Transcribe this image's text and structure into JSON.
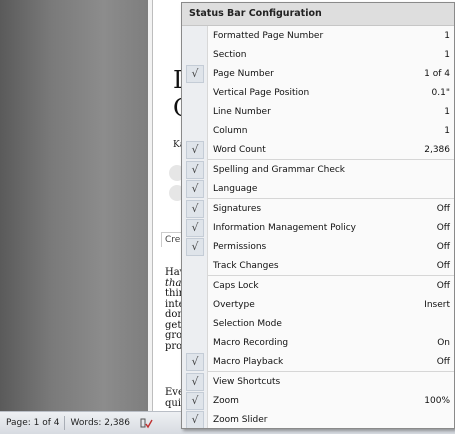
{
  "document": {
    "heading1": "In",
    "heading2": "C",
    "author": "Kat",
    "caption": "Crea",
    "body_lines": [
      "Havi",
      "that",
      "thing",
      "inte",
      "don'",
      "get s",
      "grow",
      "prod"
    ],
    "body_lines2": [
      "Ever",
      "quic"
    ]
  },
  "menu": {
    "title": "Status Bar Configuration",
    "items": [
      {
        "label": "Formatted Page Number",
        "value": "1",
        "checked": false
      },
      {
        "label": "Section",
        "value": "1",
        "checked": false
      },
      {
        "label": "Page Number",
        "value": "1 of 4",
        "checked": true
      },
      {
        "label": "Vertical Page Position",
        "value": "0.1\"",
        "checked": false
      },
      {
        "label": "Line Number",
        "value": "1",
        "checked": false
      },
      {
        "label": "Column",
        "value": "1",
        "checked": false
      },
      {
        "label": "Word Count",
        "value": "2,386",
        "checked": true
      },
      {
        "label": "Spelling and Grammar Check",
        "value": "",
        "checked": true
      },
      {
        "label": "Language",
        "value": "",
        "checked": true
      },
      {
        "label": "Signatures",
        "value": "Off",
        "checked": true
      },
      {
        "label": "Information Management Policy",
        "value": "Off",
        "checked": true
      },
      {
        "label": "Permissions",
        "value": "Off",
        "checked": true
      },
      {
        "label": "Track Changes",
        "value": "Off",
        "checked": false
      },
      {
        "label": "Caps Lock",
        "value": "Off",
        "checked": false
      },
      {
        "label": "Overtype",
        "value": "Insert",
        "checked": false
      },
      {
        "label": "Selection Mode",
        "value": "",
        "checked": false
      },
      {
        "label": "Macro Recording",
        "value": "On",
        "checked": false
      },
      {
        "label": "Macro Playback",
        "value": "Off",
        "checked": true
      },
      {
        "label": "View Shortcuts",
        "value": "",
        "checked": true
      },
      {
        "label": "Zoom",
        "value": "100%",
        "checked": true
      },
      {
        "label": "Zoom Slider",
        "value": "",
        "checked": true
      }
    ],
    "separators_after": [
      6,
      8,
      12,
      17
    ]
  },
  "statusbar": {
    "page": "Page: 1 of 4",
    "words": "Words: 2,386",
    "spell_icon": "spelling-check-icon"
  },
  "check_glyph": "√"
}
